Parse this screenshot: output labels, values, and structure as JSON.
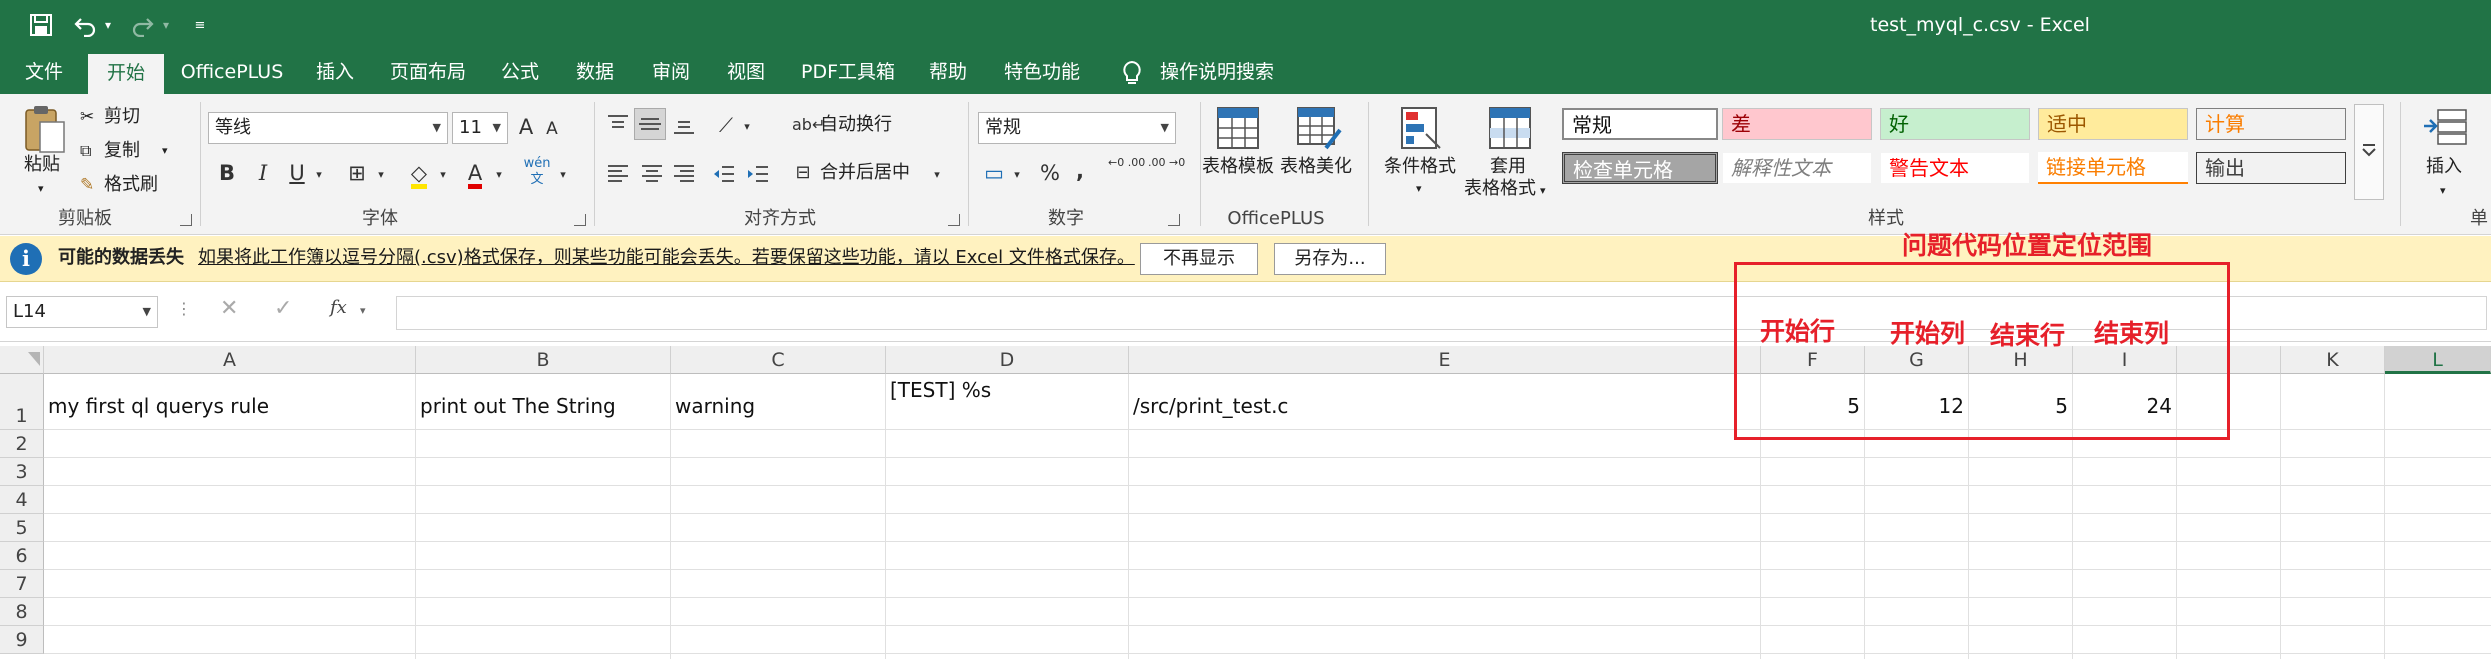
{
  "window": {
    "title": "test_myql_c.csv  -  Excel"
  },
  "tabs": [
    "文件",
    "开始",
    "OfficePLUS",
    "插入",
    "页面布局",
    "公式",
    "数据",
    "审阅",
    "视图",
    "PDF工具箱",
    "帮助",
    "特色功能",
    "操作说明搜索"
  ],
  "ribbon": {
    "clipboard": {
      "paste": "粘贴",
      "cut": "剪切",
      "copy": "复制",
      "format_painter": "格式刷",
      "label": "剪贴板"
    },
    "font": {
      "name": "等线",
      "size": "11",
      "grow": "A",
      "shrink": "A",
      "bold": "B",
      "italic": "I",
      "underline": "U",
      "phonetic": "wén",
      "label": "字体"
    },
    "alignment": {
      "wrap": "自动换行",
      "merge": "合并后居中",
      "label": "对齐方式"
    },
    "number": {
      "format": "常规",
      "percent": "%",
      "comma": ",",
      "inc_decimal": "←0 .00",
      "dec_decimal": ".00 →0",
      "label": "数字"
    },
    "officeplus": {
      "table_template": "表格模板",
      "table_beautify": "表格美化",
      "label": "OfficePLUS"
    },
    "styles": {
      "conditional": "条件格式",
      "table_format_1": "套用",
      "table_format_2": "表格格式",
      "normal": "常规",
      "bad": "差",
      "good": "好",
      "neutral": "适中",
      "calculation": "计算",
      "check_cell": "检查单元格",
      "explanatory": "解释性文本",
      "warning_text": "警告文本",
      "linked_cell": "链接单元格",
      "output": "输出",
      "label": "样式"
    },
    "cells": {
      "insert": "插入",
      "label": "单"
    }
  },
  "infobar": {
    "title": "可能的数据丢失",
    "message": "如果将此工作簿以逗号分隔(.csv)格式保存，则某些功能可能会丢失。若要保留这些功能，请以 Excel 文件格式保存。",
    "dont_show": "不再显示",
    "save_as": "另存为..."
  },
  "formula_bar": {
    "name_box": "L14",
    "fx": "fx",
    "value": ""
  },
  "columns": [
    "A",
    "B",
    "C",
    "D",
    "E",
    "F",
    "G",
    "H",
    "I",
    "K",
    "L"
  ],
  "rows": [
    "1",
    "2",
    "3",
    "4",
    "5",
    "6",
    "7",
    "8",
    "9"
  ],
  "row1": {
    "A": "my first ql querys rule",
    "B": "print out The String",
    "C": "warning",
    "D": "[TEST] %s",
    "E": "/src/print_test.c",
    "F": "5",
    "G": "12",
    "H": "5",
    "I": "24"
  },
  "annotations": {
    "title": "问题代码位置定位范围",
    "start_row": "开始行",
    "start_col": "开始列",
    "end_row": "结束行",
    "end_col": "结束列"
  },
  "colors": {
    "brand": "#217346",
    "annotation": "#e6202a",
    "infobar": "#fff2c0"
  }
}
